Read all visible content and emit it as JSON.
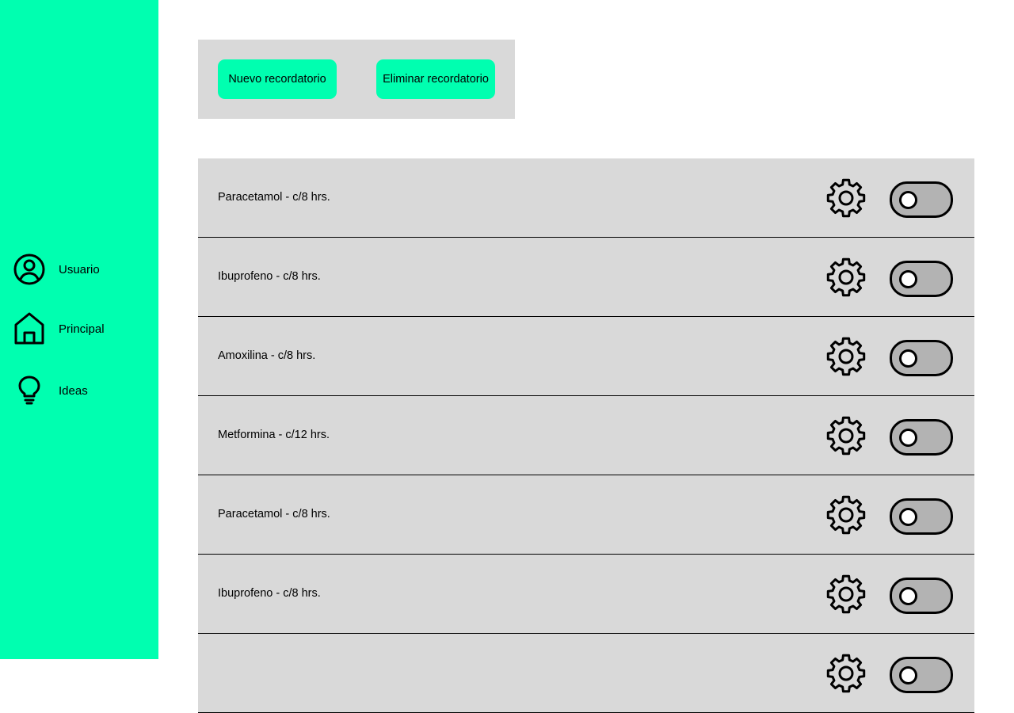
{
  "colors": {
    "accent": "#00FFB0",
    "panel": "#D9D9D9",
    "toggle_off": "#B3B3B3"
  },
  "sidebar": {
    "items": [
      {
        "label": "Usuario",
        "icon": "user-circle-icon"
      },
      {
        "label": "Principal",
        "icon": "home-icon"
      },
      {
        "label": "Ideas",
        "icon": "lightbulb-icon"
      }
    ]
  },
  "toolbar": {
    "new_label": "Nuevo recordatorio",
    "delete_label": "Eliminar recordatorio"
  },
  "reminders": [
    {
      "text": "Paracetamol - c/8 hrs.",
      "enabled": false
    },
    {
      "text": "Ibuprofeno - c/8 hrs.",
      "enabled": false
    },
    {
      "text": "Amoxilina - c/8 hrs.",
      "enabled": false
    },
    {
      "text": "Metformina - c/12 hrs.",
      "enabled": false
    },
    {
      "text": "Paracetamol - c/8 hrs.",
      "enabled": false
    },
    {
      "text": "Ibuprofeno - c/8 hrs.",
      "enabled": false
    },
    {
      "text": "",
      "enabled": false
    }
  ]
}
